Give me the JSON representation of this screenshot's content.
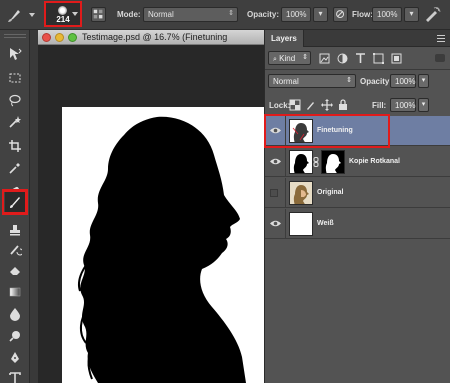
{
  "options_bar": {
    "brush_size": "214",
    "mode_label": "Mode:",
    "mode_value": "Normal",
    "opacity_label": "Opacity:",
    "opacity_value": "100%",
    "flow_label": "Flow:",
    "flow_value": "100%",
    "tool_icons": [
      "brush-tool-icon",
      "brush-panel-icon",
      "pressure-opacity-icon",
      "airbrush-icon",
      "pressure-size-icon"
    ]
  },
  "toolbar": {
    "tools": [
      "move",
      "marquee",
      "lasso",
      "quick-select",
      "crop",
      "eyedropper",
      "healing",
      "brush",
      "clone-stamp",
      "history-brush",
      "eraser",
      "gradient",
      "blur",
      "dodge",
      "pen",
      "type"
    ],
    "active_tool": "brush"
  },
  "document": {
    "title": "Testimage.psd @ 16.7% (Finetuning",
    "traffic_lights": [
      "close",
      "minimize",
      "zoom"
    ]
  },
  "layers_panel": {
    "tab_label": "Layers",
    "filter_kind": "Kind",
    "blend_mode": "Normal",
    "opacity_label": "Opacity:",
    "opacity_value": "100%",
    "lock_label": "Lock:",
    "fill_label": "Fill:",
    "fill_value": "100%",
    "layers": [
      {
        "name": "Finetuning",
        "visible": true,
        "selected": true
      },
      {
        "name": "Kopie Rotkanal",
        "visible": true,
        "selected": false
      },
      {
        "name": "Original",
        "visible": false,
        "selected": false
      },
      {
        "name": "Weiß",
        "visible": true,
        "selected": false
      }
    ]
  },
  "colors": {
    "highlight": "#e01b1b",
    "selected_layer": "#6e7ea3"
  }
}
